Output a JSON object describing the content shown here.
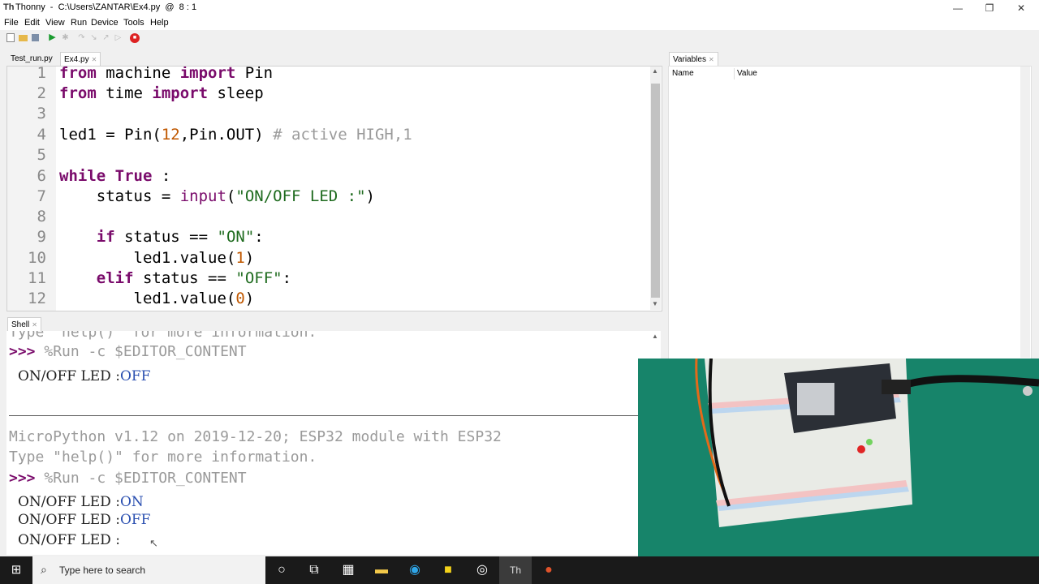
{
  "window": {
    "title": "Thonny  -  C:\\Users\\ZANTAR\\Ex4.py  @  8 : 1",
    "logo": "Th",
    "minimize": "—",
    "maximize": "❐",
    "close": "✕"
  },
  "menu": [
    "File",
    "Edit",
    "View",
    "Run",
    "Device",
    "Tools",
    "Help"
  ],
  "toolbar_icons": [
    "new-file-icon",
    "open-file-icon",
    "save-icon",
    "run-icon",
    "debug-icon",
    "step-over-icon",
    "step-into-icon",
    "step-out-icon",
    "resume-icon",
    "stop-icon"
  ],
  "editor_tabs": [
    {
      "label": "Test_run.py",
      "active": false
    },
    {
      "label": "Ex4.py",
      "active": true
    }
  ],
  "editor": {
    "line_numbers": [
      "1",
      "2",
      "3",
      "4",
      "5",
      "6",
      "7",
      "8",
      "9",
      "10",
      "11",
      "12"
    ]
  },
  "variables": {
    "tab_label": "Variables",
    "col_name": "Name",
    "col_value": "Value"
  },
  "shell": {
    "tab_label": "Shell",
    "lines": {
      "l0": "Type \"help()\" for more information.",
      "l1_prompt": ">>>",
      "l1_cmd": " %Run -c $EDITOR_CONTENT",
      "l2_label": "ON/OFF LED :",
      "l2_value": "OFF",
      "l3": "MicroPython v1.12 on 2019-12-20; ESP32 module with ESP32",
      "l4": "Type \"help()\" for more information.",
      "l5_prompt": ">>>",
      "l5_cmd": " %Run -c $EDITOR_CONTENT",
      "l6_label": "ON/OFF LED :",
      "l6_value": "ON",
      "l7_label": "ON/OFF LED :",
      "l7_value": "OFF",
      "l8_label": "ON/OFF LED :"
    }
  },
  "taskbar": {
    "search_placeholder": "Type here to search",
    "apps": [
      "cortana-icon",
      "task-view-icon",
      "calculator-icon",
      "file-explorer-icon",
      "edge-icon",
      "sticky-notes-icon",
      "obs-icon",
      "thonny-icon",
      "powerpoint-icon"
    ]
  },
  "colors": {
    "keyword": "#7a0b6b",
    "number": "#c05800",
    "string": "#1d6a1d",
    "comment": "#9a9a9a",
    "shell_value": "#2a4fb0"
  }
}
